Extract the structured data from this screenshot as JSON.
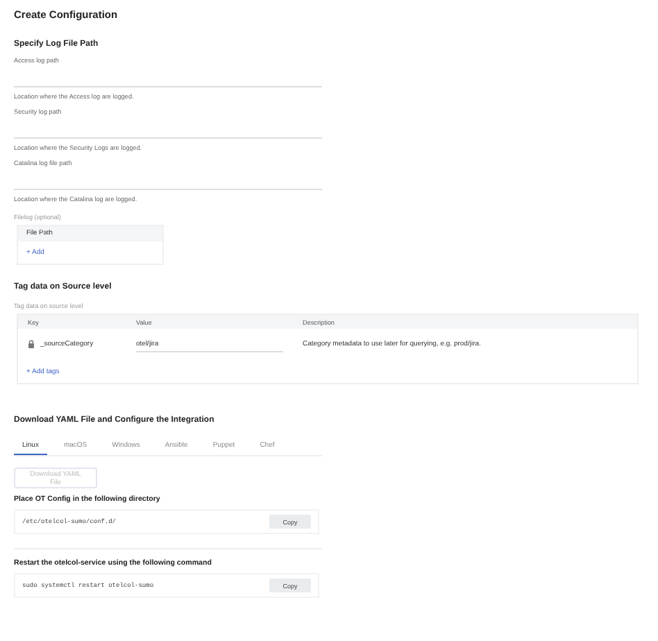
{
  "title": "Create Configuration",
  "log_section": {
    "heading": "Specify Log File Path",
    "fields": [
      {
        "label": "Access log path",
        "help": "Location where the Access log are logged."
      },
      {
        "label": "Security log path",
        "help": "Location where the Security Logs are logged."
      },
      {
        "label": "Catalina log file path",
        "help": "Location where the Catalina log are logged."
      }
    ],
    "filelog": {
      "label": "Filelog (optional)",
      "column": "File Path",
      "add": "+ Add"
    }
  },
  "tag_section": {
    "heading": "Tag data on Source level",
    "label": "Tag data on source level",
    "columns": [
      "Key",
      "Value",
      "Description"
    ],
    "rows": [
      {
        "key": "_sourceCategory",
        "locked": true,
        "value": "otel/jira",
        "description": "Category metadata to use later for querying, e.g. prod/jira."
      }
    ],
    "add": "+ Add tags"
  },
  "download_section": {
    "heading": "Download YAML File and Configure the Integration",
    "tabs": [
      {
        "label": "Linux",
        "selected": true
      },
      {
        "label": "macOS",
        "selected": false
      },
      {
        "label": "Windows",
        "selected": false
      },
      {
        "label": "Ansible",
        "selected": false
      },
      {
        "label": "Puppet",
        "selected": false
      },
      {
        "label": "Chef",
        "selected": false
      }
    ],
    "download_button": {
      "label": "Download YAML File",
      "disabled": true
    },
    "steps": [
      {
        "title": "Place OT Config in the following directory",
        "code": "/etc/otelcol-sumo/conf.d/",
        "copy": "Copy"
      },
      {
        "title": "Restart the otelcol-service using the following command",
        "code": "sudo systemctl restart otelcol-sumo",
        "copy": "Copy"
      }
    ]
  }
}
